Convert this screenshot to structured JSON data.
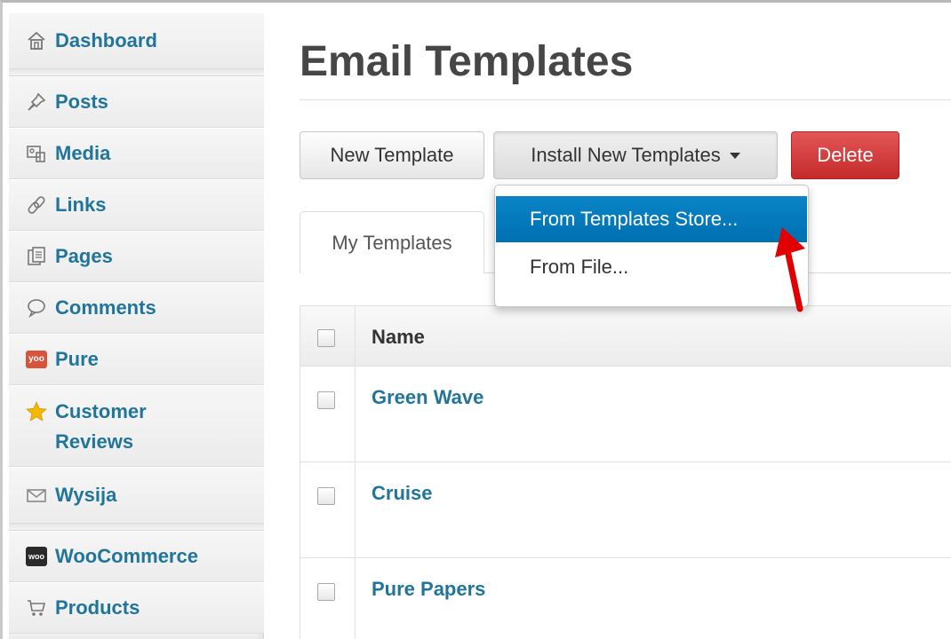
{
  "sidebar": {
    "items": [
      {
        "label": "Dashboard",
        "icon": "house-icon"
      },
      {
        "label": "Posts",
        "icon": "pushpin-icon"
      },
      {
        "label": "Media",
        "icon": "media-icon"
      },
      {
        "label": "Links",
        "icon": "chain-link-icon"
      },
      {
        "label": "Pages",
        "icon": "pages-icon"
      },
      {
        "label": "Comments",
        "icon": "speech-bubble-icon"
      },
      {
        "label": "Pure",
        "icon": "yoo-logo-icon",
        "icon_text": "yoo"
      },
      {
        "label": "Customer Reviews",
        "label_line1": "Customer",
        "label_line2": "Reviews",
        "icon": "star-icon"
      },
      {
        "label": "Wysija",
        "icon": "envelope-icon"
      },
      {
        "label": "WooCommerce",
        "icon": "woo-logo-icon",
        "icon_text": "woo"
      },
      {
        "label": "Products",
        "icon": "shopping-cart-icon"
      }
    ]
  },
  "page": {
    "title": "Email Templates"
  },
  "toolbar": {
    "new_template": "New Template",
    "install_new_templates": "Install New Templates",
    "delete": "Delete"
  },
  "dropdown": {
    "items": [
      "From Templates Store...",
      "From File..."
    ],
    "active_index": 0
  },
  "tabs": {
    "my_templates": "My Templates"
  },
  "table": {
    "header": {
      "name": "Name"
    },
    "rows": [
      {
        "name": "Green Wave"
      },
      {
        "name": "Cruise"
      },
      {
        "name": "Pure Papers"
      }
    ]
  },
  "colors": {
    "link": "#21759b",
    "delete_button": "#c52a2a",
    "dropdown_active": "#0a7fc0",
    "arrow": "#e00000",
    "star": "#f5b800"
  }
}
